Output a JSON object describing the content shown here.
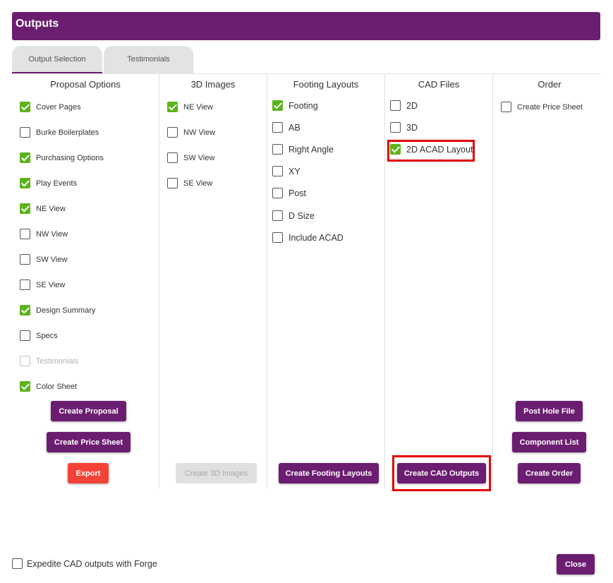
{
  "dialog": {
    "title": "Outputs"
  },
  "tabs": [
    {
      "label": "Output Selection",
      "active": true
    },
    {
      "label": "Testimonials",
      "active": false
    }
  ],
  "columns": {
    "proposal": {
      "header": "Proposal Options",
      "items": [
        {
          "label": "Cover Pages",
          "checked": true
        },
        {
          "label": "Burke Boilerplates",
          "checked": false
        },
        {
          "label": "Purchasing Options",
          "checked": true
        },
        {
          "label": "Play Events",
          "checked": true
        },
        {
          "label": "NE View",
          "checked": true
        },
        {
          "label": "NW View",
          "checked": false
        },
        {
          "label": "SW View",
          "checked": false
        },
        {
          "label": "SE View",
          "checked": false
        },
        {
          "label": "Design Summary",
          "checked": true
        },
        {
          "label": "Specs",
          "checked": false
        },
        {
          "label": "Testimonials",
          "checked": false,
          "disabled": true
        },
        {
          "label": "Color Sheet",
          "checked": true
        }
      ],
      "buttons": {
        "create_proposal": "Create Proposal",
        "create_price_sheet": "Create Price Sheet",
        "export": "Export"
      }
    },
    "images3d": {
      "header": "3D Images",
      "items": [
        {
          "label": "NE View",
          "checked": true
        },
        {
          "label": "NW View",
          "checked": false
        },
        {
          "label": "SW View",
          "checked": false
        },
        {
          "label": "SE View",
          "checked": false
        }
      ],
      "buttons": {
        "create_3d_images": "Create 3D Images"
      }
    },
    "footing": {
      "header": "Footing Layouts",
      "items": [
        {
          "label": "Footing",
          "checked": true
        },
        {
          "label": "AB",
          "checked": false
        },
        {
          "label": "Right Angle",
          "checked": false
        },
        {
          "label": "XY",
          "checked": false
        },
        {
          "label": "Post",
          "checked": false
        },
        {
          "label": "D Size",
          "checked": false
        },
        {
          "label": "Include ACAD",
          "checked": false
        }
      ],
      "buttons": {
        "create_footing_layouts": "Create Footing Layouts"
      }
    },
    "cad": {
      "header": "CAD Files",
      "items": [
        {
          "label": "2D",
          "checked": false
        },
        {
          "label": "3D",
          "checked": false
        },
        {
          "label": "2D ACAD Layout",
          "checked": true
        }
      ],
      "buttons": {
        "create_cad_outputs": "Create CAD Outputs"
      }
    },
    "order": {
      "header": "Order",
      "items": [
        {
          "label": "Create Price Sheet",
          "checked": false
        }
      ],
      "buttons": {
        "post_hole_file": "Post Hole File",
        "component_list": "Component List",
        "create_order": "Create Order"
      }
    }
  },
  "footer": {
    "expedite_label": "Expedite CAD outputs with Forge",
    "expedite_checked": false,
    "close_label": "Close"
  },
  "colors": {
    "brand": "#6b1d70",
    "check": "#5cb31a",
    "danger": "#f44336",
    "highlight": "#e00000"
  }
}
